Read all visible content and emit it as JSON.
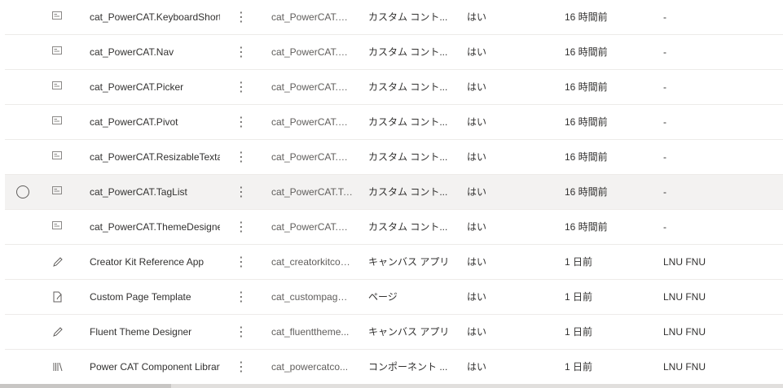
{
  "rows": [
    {
      "icon": "custom-control-icon",
      "name": "cat_PowerCAT.KeyboardShortcuts",
      "schema_name": "cat_PowerCAT.Ke...",
      "type": "カスタム コント...",
      "managed": "はい",
      "modified": "16 時間前",
      "owner": "-",
      "selected": false
    },
    {
      "icon": "custom-control-icon",
      "name": "cat_PowerCAT.Nav",
      "schema_name": "cat_PowerCAT.Nav",
      "type": "カスタム コント...",
      "managed": "はい",
      "modified": "16 時間前",
      "owner": "-",
      "selected": false
    },
    {
      "icon": "custom-control-icon",
      "name": "cat_PowerCAT.Picker",
      "schema_name": "cat_PowerCAT.Pi...",
      "type": "カスタム コント...",
      "managed": "はい",
      "modified": "16 時間前",
      "owner": "-",
      "selected": false
    },
    {
      "icon": "custom-control-icon",
      "name": "cat_PowerCAT.Pivot",
      "schema_name": "cat_PowerCAT.Pi...",
      "type": "カスタム コント...",
      "managed": "はい",
      "modified": "16 時間前",
      "owner": "-",
      "selected": false
    },
    {
      "icon": "custom-control-icon",
      "name": "cat_PowerCAT.ResizableTextarea",
      "schema_name": "cat_PowerCAT.Re...",
      "type": "カスタム コント...",
      "managed": "はい",
      "modified": "16 時間前",
      "owner": "-",
      "selected": false
    },
    {
      "icon": "custom-control-icon",
      "name": "cat_PowerCAT.TagList",
      "schema_name": "cat_PowerCAT.Ta...",
      "type": "カスタム コント...",
      "managed": "はい",
      "modified": "16 時間前",
      "owner": "-",
      "selected": true
    },
    {
      "icon": "custom-control-icon",
      "name": "cat_PowerCAT.ThemeDesigner",
      "schema_name": "cat_PowerCAT.Th...",
      "type": "カスタム コント...",
      "managed": "はい",
      "modified": "16 時間前",
      "owner": "-",
      "selected": false
    },
    {
      "icon": "canvas-app-pencil-icon",
      "name": "Creator Kit Reference App",
      "schema_name": "cat_creatorkitcon...",
      "type": "キャンバス アプリ",
      "managed": "はい",
      "modified": "1 日前",
      "owner": "LNU FNU",
      "selected": false
    },
    {
      "icon": "page-icon",
      "name": "Custom Page Template",
      "schema_name": "cat_custompaget...",
      "type": "ページ",
      "managed": "はい",
      "modified": "1 日前",
      "owner": "LNU FNU",
      "selected": false
    },
    {
      "icon": "canvas-app-pencil-icon",
      "name": "Fluent Theme Designer",
      "schema_name": "cat_fluenttheme...",
      "type": "キャンバス アプリ",
      "managed": "はい",
      "modified": "1 日前",
      "owner": "LNU FNU",
      "selected": false
    },
    {
      "icon": "library-icon",
      "name": "Power CAT Component Library",
      "schema_name": "cat_powercatco...",
      "type": "コンポーネント ...",
      "managed": "はい",
      "modified": "1 日前",
      "owner": "LNU FNU",
      "selected": false
    }
  ],
  "more_glyph": "⋮",
  "colors": {
    "row_border": "#edebe9",
    "selected_bg": "#f3f2f1",
    "text": "#323130",
    "muted": "#605e5c"
  }
}
